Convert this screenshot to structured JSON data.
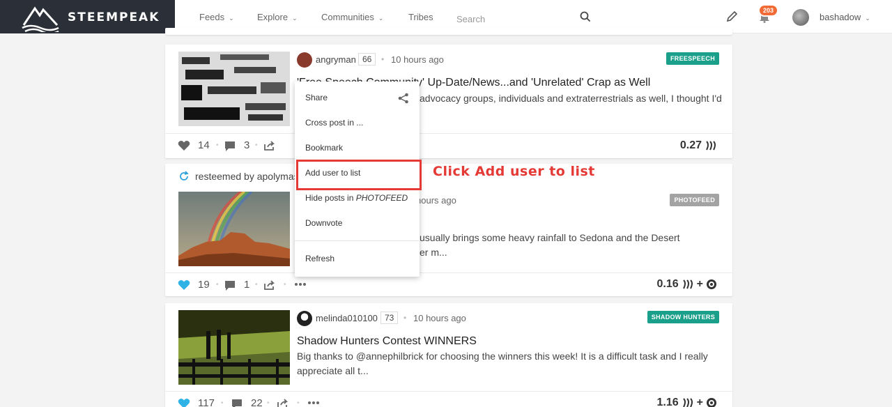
{
  "header": {
    "logo_text": "STEEMPEAK",
    "nav": [
      {
        "label": "Feeds",
        "dropdown": true
      },
      {
        "label": "Explore",
        "dropdown": true
      },
      {
        "label": "Communities",
        "dropdown": true
      },
      {
        "label": "Tribes",
        "dropdown": false
      }
    ],
    "search_placeholder": "Search",
    "notification_count": "203",
    "username": "bashadow"
  },
  "posts": [
    {
      "author": "angryman",
      "reputation": "66",
      "time": "10 hours ago",
      "tag": "FREESPEECH",
      "tag_color": "#1a9f8a",
      "title": "'Free Speech Community' Up-Date/News...and 'Unrelated' Crap as Well",
      "excerpt": "advocacy groups, individuals and extraterrestrials as well, I thought I'd",
      "likes": "14",
      "comments": "3",
      "payout": "0.27"
    },
    {
      "resteemed_by": "resteemed by apolymas",
      "time": "hours ago",
      "tag": "PHOTOFEED",
      "tag_color": "#a3a3a3",
      "excerpt_line1": "usually brings some heavy rainfall to Sedona and the Desert",
      "excerpt_line2": "er m...",
      "likes": "19",
      "comments": "1",
      "payout": "0.16"
    },
    {
      "author": "melinda010100",
      "reputation": "73",
      "time": "10 hours ago",
      "tag": "SHADOW HUNTERS",
      "tag_color": "#1a9f8a",
      "title": "Shadow Hunters Contest WINNERS",
      "excerpt": "Big thanks to @annephilbrick for choosing the winners this week! It is a difficult task and I really appreciate all t...",
      "likes": "117",
      "comments": "22",
      "payout": "1.16"
    }
  ],
  "menu": {
    "share": "Share",
    "cross_post": "Cross post in ...",
    "bookmark": "Bookmark",
    "add_user": "Add user to list",
    "hide_posts_prefix": "Hide posts in",
    "hide_posts_tag": "PHOTOFEED",
    "downvote": "Downvote",
    "refresh": "Refresh"
  },
  "annotation": "Click Add user to list",
  "colors": {
    "logo_bg": "#2b3038",
    "accent_teal": "#1a9f8a",
    "like_blue": "#2fb3e6",
    "badge_orange": "#f26a35",
    "highlight_red": "#e53935"
  }
}
